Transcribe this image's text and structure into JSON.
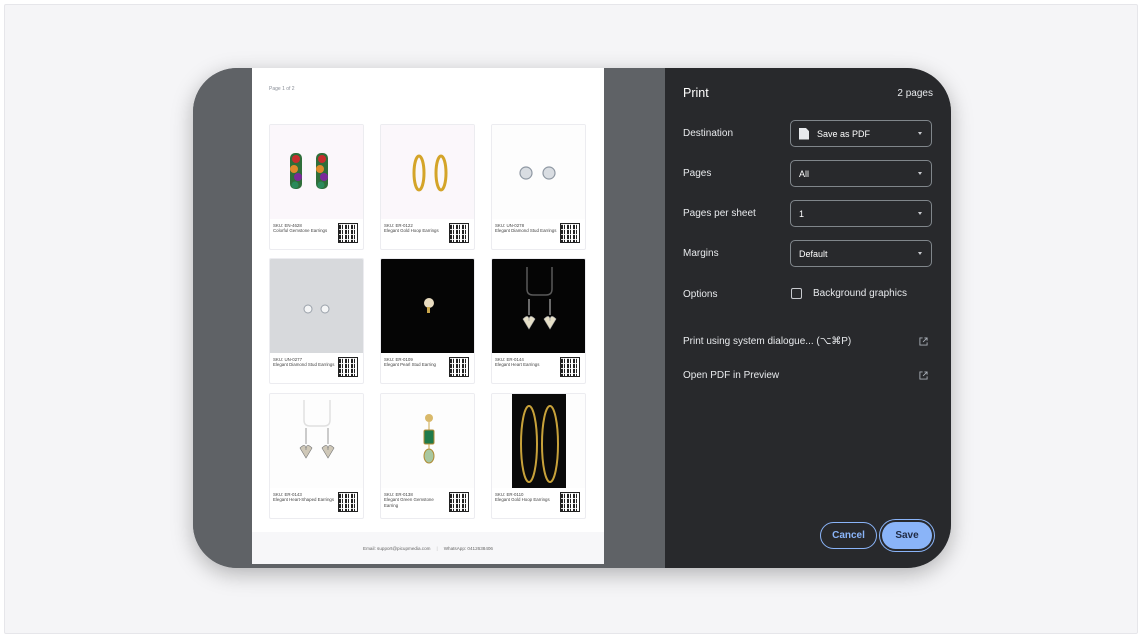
{
  "preview": {
    "page_label": "Page 1 of 2",
    "products": [
      {
        "sku": "SKU: EN-4628",
        "name": "Colorful Gemstone Earrings",
        "bg": "light",
        "art": "gem-hoops"
      },
      {
        "sku": "SKU: ER-0122",
        "name": "Elegant Gold Hoop Earrings",
        "bg": "light",
        "art": "gold-hoops"
      },
      {
        "sku": "SKU: UN-0278",
        "name": "Elegant Diamond Stud Earrings",
        "bg": "white",
        "art": "diamond-studs"
      },
      {
        "sku": "SKU: UN-0277",
        "name": "Elegant Diamond Stud Earrings",
        "bg": "grey",
        "art": "diamond-studs-small"
      },
      {
        "sku": "SKU: ER-0109",
        "name": "Elegant Pearl Stud Earring",
        "bg": "black",
        "art": "pearl"
      },
      {
        "sku": "SKU: ER-0144",
        "name": "Elegant Heart Earrings",
        "bg": "black",
        "art": "hearts"
      },
      {
        "sku": "SKU: ER-0143",
        "name": "Elegant Heart-Shaped Earrings",
        "bg": "white",
        "art": "hearts-light"
      },
      {
        "sku": "SKU: ER-0138",
        "name": "Elegant Green Gemstone Earring",
        "bg": "white",
        "art": "green-gem"
      },
      {
        "sku": "SKU: ER-0110",
        "name": "Elegant Gold Hoop Earrings",
        "bg": "white",
        "art": "big-hoops"
      }
    ],
    "footer": {
      "email": "Email: support@picupmedia.com",
      "whatsapp": "WhatsApp: 0412638406"
    }
  },
  "print_panel": {
    "title": "Print",
    "page_count": "2 pages",
    "destination": {
      "label": "Destination",
      "value": "Save as PDF"
    },
    "pages": {
      "label": "Pages",
      "value": "All"
    },
    "pages_per_sheet": {
      "label": "Pages per sheet",
      "value": "1"
    },
    "margins": {
      "label": "Margins",
      "value": "Default"
    },
    "options": {
      "label": "Options",
      "background_graphics": "Background graphics"
    },
    "system_dialogue": "Print using system dialogue... (⌥⌘P)",
    "open_preview": "Open PDF in Preview",
    "cancel": "Cancel",
    "save": "Save"
  },
  "colors": {
    "panel_bg": "#28292c",
    "accent": "#8ab4f8",
    "preview_bg": "#5f6266"
  }
}
